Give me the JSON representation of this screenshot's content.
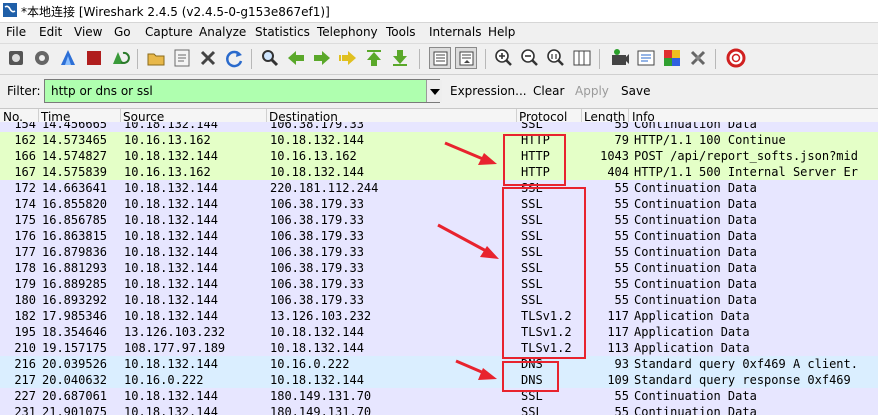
{
  "window": {
    "title": "*本地连接 [Wireshark 2.4.5 (v2.4.5-0-g153e867ef1)]"
  },
  "menu": [
    "File",
    "Edit",
    "View",
    "Go",
    "Capture",
    "Analyze",
    "Statistics",
    "Telephony",
    "Tools",
    "Internals",
    "Help"
  ],
  "toolbar": {
    "icons": [
      "interface-list-icon",
      "capture-options-icon",
      "start-capture-icon",
      "stop-capture-icon",
      "restart-capture-icon",
      "open-file-icon",
      "save-file-icon",
      "close-file-icon",
      "reload-icon",
      "find-packet-icon",
      "go-back-icon",
      "go-forward-icon",
      "go-to-packet-icon",
      "go-first-icon",
      "go-last-icon",
      "colorize-icon",
      "auto-scroll-icon",
      "zoom-in-icon",
      "zoom-out-icon",
      "normal-size-icon",
      "resize-columns-icon",
      "capture-filters-icon",
      "display-filters-icon",
      "coloring-rules-icon",
      "preferences-icon",
      "help-icon"
    ]
  },
  "filter": {
    "label": "Filter:",
    "value": "http or dns or ssl",
    "actions": [
      "Expression...",
      "Clear",
      "Apply",
      "Save"
    ]
  },
  "columns": [
    "No.",
    "Time",
    "Source",
    "Destination",
    "Protocol",
    "Length",
    "Info"
  ],
  "colors": {
    "http_row": "#e4ffc7",
    "tcp_row": "#e7e6ff",
    "dns_row": "#daeeff",
    "annotation": "#e8232e"
  },
  "packets": [
    {
      "no": "154",
      "time": "14.456665",
      "src": "10.18.132.144",
      "dst": "106.38.179.33",
      "proto": "SSL",
      "len": "55",
      "info": "Continuation Data",
      "kind": "tcp"
    },
    {
      "no": "162",
      "time": "14.573465",
      "src": "10.16.13.162",
      "dst": "10.18.132.144",
      "proto": "HTTP",
      "len": "79",
      "info": "HTTP/1.1 100 Continue",
      "kind": "http"
    },
    {
      "no": "166",
      "time": "14.574827",
      "src": "10.18.132.144",
      "dst": "10.16.13.162",
      "proto": "HTTP",
      "len": "1043",
      "info": "POST /api/report_softs.json?mid",
      "kind": "http"
    },
    {
      "no": "167",
      "time": "14.575839",
      "src": "10.16.13.162",
      "dst": "10.18.132.144",
      "proto": "HTTP",
      "len": "404",
      "info": "HTTP/1.1 500 Internal Server Er",
      "kind": "http"
    },
    {
      "no": "172",
      "time": "14.663641",
      "src": "10.18.132.144",
      "dst": "220.181.112.244",
      "proto": "SSL",
      "len": "55",
      "info": "Continuation Data",
      "kind": "tcp"
    },
    {
      "no": "174",
      "time": "16.855820",
      "src": "10.18.132.144",
      "dst": "106.38.179.33",
      "proto": "SSL",
      "len": "55",
      "info": "Continuation Data",
      "kind": "tcp"
    },
    {
      "no": "175",
      "time": "16.856785",
      "src": "10.18.132.144",
      "dst": "106.38.179.33",
      "proto": "SSL",
      "len": "55",
      "info": "Continuation Data",
      "kind": "tcp"
    },
    {
      "no": "176",
      "time": "16.863815",
      "src": "10.18.132.144",
      "dst": "106.38.179.33",
      "proto": "SSL",
      "len": "55",
      "info": "Continuation Data",
      "kind": "tcp"
    },
    {
      "no": "177",
      "time": "16.879836",
      "src": "10.18.132.144",
      "dst": "106.38.179.33",
      "proto": "SSL",
      "len": "55",
      "info": "Continuation Data",
      "kind": "tcp"
    },
    {
      "no": "178",
      "time": "16.881293",
      "src": "10.18.132.144",
      "dst": "106.38.179.33",
      "proto": "SSL",
      "len": "55",
      "info": "Continuation Data",
      "kind": "tcp"
    },
    {
      "no": "179",
      "time": "16.889285",
      "src": "10.18.132.144",
      "dst": "106.38.179.33",
      "proto": "SSL",
      "len": "55",
      "info": "Continuation Data",
      "kind": "tcp"
    },
    {
      "no": "180",
      "time": "16.893292",
      "src": "10.18.132.144",
      "dst": "106.38.179.33",
      "proto": "SSL",
      "len": "55",
      "info": "Continuation Data",
      "kind": "tcp"
    },
    {
      "no": "182",
      "time": "17.985346",
      "src": "10.18.132.144",
      "dst": "13.126.103.232",
      "proto": "TLSv1.2",
      "len": "117",
      "info": "Application Data",
      "kind": "tcp"
    },
    {
      "no": "195",
      "time": "18.354646",
      "src": "13.126.103.232",
      "dst": "10.18.132.144",
      "proto": "TLSv1.2",
      "len": "117",
      "info": "Application Data",
      "kind": "tcp"
    },
    {
      "no": "210",
      "time": "19.157175",
      "src": "108.177.97.189",
      "dst": "10.18.132.144",
      "proto": "TLSv1.2",
      "len": "113",
      "info": "Application Data",
      "kind": "tcp"
    },
    {
      "no": "216",
      "time": "20.039526",
      "src": "10.18.132.144",
      "dst": "10.16.0.222",
      "proto": "DNS",
      "len": "93",
      "info": "Standard query 0xf469 A client.",
      "kind": "dns"
    },
    {
      "no": "217",
      "time": "20.040632",
      "src": "10.16.0.222",
      "dst": "10.18.132.144",
      "proto": "DNS",
      "len": "109",
      "info": "Standard query response 0xf469",
      "kind": "dns"
    },
    {
      "no": "227",
      "time": "20.687061",
      "src": "10.18.132.144",
      "dst": "180.149.131.70",
      "proto": "SSL",
      "len": "55",
      "info": "Continuation Data",
      "kind": "tcp"
    },
    {
      "no": "231",
      "time": "21.901075",
      "src": "10.18.132.144",
      "dst": "180.149.131.70",
      "proto": "SSL",
      "len": "55",
      "info": "Continuation Data",
      "kind": "tcp"
    }
  ]
}
